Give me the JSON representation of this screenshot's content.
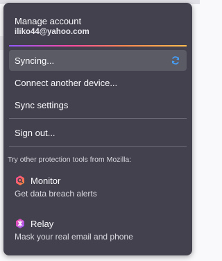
{
  "account": {
    "title": "Manage account",
    "email": "iliko44@yahoo.com"
  },
  "menu": {
    "syncing_label": "Syncing...",
    "sync_icon": "sync-refresh-icon",
    "connect_device_label": "Connect another device...",
    "sync_settings_label": "Sync settings",
    "sign_out_label": "Sign out..."
  },
  "tools": {
    "header": "Try other protection tools from Mozilla:",
    "monitor": {
      "name": "Monitor",
      "description": "Get data breach alerts",
      "icon": "monitor-icon"
    },
    "relay": {
      "name": "Relay",
      "description": "Mask your real email and phone",
      "icon": "relay-icon"
    }
  },
  "colors": {
    "panel_bg": "#42414d",
    "hover_bg": "#5b5b66",
    "text": "#fbfbfe",
    "sync_icon": "#45a1ff",
    "monitor_accent": "#ff6a5a",
    "relay_accent": "#9059ff"
  }
}
